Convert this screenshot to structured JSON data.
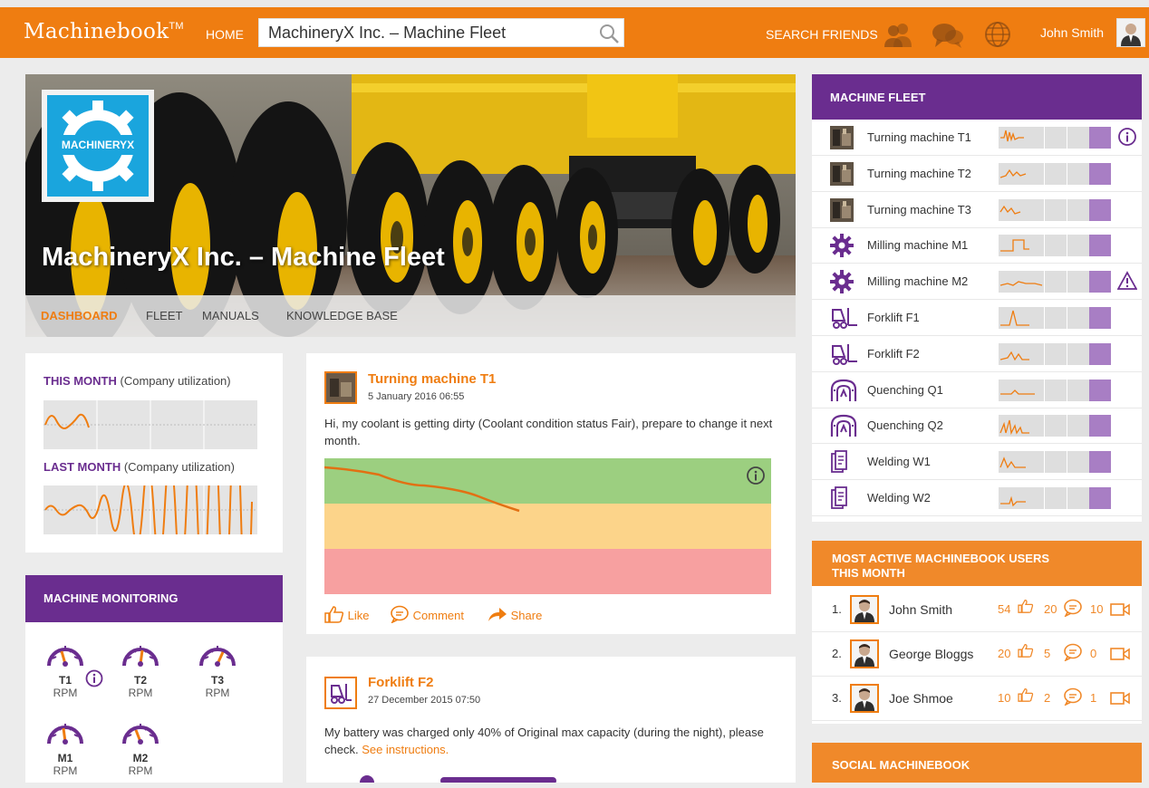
{
  "topbar": {
    "logo": "Machinebook",
    "logo_tm": "TM",
    "home": "HOME",
    "search_value": "MachineryX Inc. – Machine Fleet",
    "search_friends": "SEARCH FRIENDS",
    "user_name": "John Smith",
    "brand_color": "#ef7d11"
  },
  "hero": {
    "logo_text": "MACHINERYX",
    "title": "MachineryX Inc. – Machine Fleet",
    "tabs": [
      "DASHBOARD",
      "FLEET",
      "MANUALS",
      "KNOWLEDGE BASE"
    ],
    "active_tab": "DASHBOARD"
  },
  "utilization": {
    "this_month_bold": "THIS MONTH",
    "this_month_rest": " (Company utilization)",
    "last_month_bold": "LAST MONTH",
    "last_month_rest": " (Company utilization)"
  },
  "monitoring": {
    "title": "MACHINE MONITORING",
    "gauges": [
      {
        "name": "T1",
        "unit": "RPM"
      },
      {
        "name": "T2",
        "unit": "RPM"
      },
      {
        "name": "T3",
        "unit": "RPM"
      },
      {
        "name": "M1",
        "unit": "RPM"
      },
      {
        "name": "M2",
        "unit": "RPM"
      }
    ]
  },
  "posts": [
    {
      "title": "Turning machine T1",
      "date": "5 January 2016  06:55",
      "body": "Hi, my coolant is getting dirty (Coolant condition status Fair), prepare to change it next month.",
      "actions": {
        "like": "Like",
        "comment": "Comment",
        "share": "Share"
      }
    },
    {
      "title": "Forklift F2",
      "date": "27 December 2015  07:50",
      "body": "My battery was charged only 40% of Original max capacity (during the night), please check. ",
      "link": "See instructions."
    }
  ],
  "fleet": {
    "title": "MACHINE FLEET",
    "items": [
      {
        "name": "Turning machine T1",
        "icon": "turning-machine-icon",
        "status": "info"
      },
      {
        "name": "Turning machine T2",
        "icon": "turning-machine-icon",
        "status": ""
      },
      {
        "name": "Turning machine T3",
        "icon": "turning-machine-icon",
        "status": ""
      },
      {
        "name": "Milling machine M1",
        "icon": "milling-gear-icon",
        "status": ""
      },
      {
        "name": "Milling machine M2",
        "icon": "milling-gear-icon",
        "status": "warning"
      },
      {
        "name": "Forklift F1",
        "icon": "forklift-icon",
        "status": ""
      },
      {
        "name": "Forklift F2",
        "icon": "forklift-icon",
        "status": ""
      },
      {
        "name": "Quenching Q1",
        "icon": "quenching-icon",
        "status": ""
      },
      {
        "name": "Quenching Q2",
        "icon": "quenching-icon",
        "status": ""
      },
      {
        "name": "Welding W1",
        "icon": "welding-icon",
        "status": ""
      },
      {
        "name": "Welding W2",
        "icon": "welding-icon",
        "status": ""
      }
    ]
  },
  "active_users": {
    "title_line1": "MOST ACTIVE MACHINEBOOK USERS",
    "title_line2": "THIS MONTH",
    "users": [
      {
        "rank": "1.",
        "name": "John Smith",
        "likes": "54",
        "comments": "20",
        "videos": "10"
      },
      {
        "rank": "2.",
        "name": "George Bloggs",
        "likes": "20",
        "comments": "5",
        "videos": "0"
      },
      {
        "rank": "3.",
        "name": "Joe Shmoe",
        "likes": "10",
        "comments": "2",
        "videos": "1"
      }
    ]
  },
  "social": {
    "title": "SOCIAL MACHINEBOOK"
  },
  "colors": {
    "accent_orange": "#ef7d11",
    "accent_purple": "#6a2d8f",
    "status_green": "#9ccf80",
    "status_yellow": "#fcd48a",
    "status_red": "#f7a0a0"
  }
}
